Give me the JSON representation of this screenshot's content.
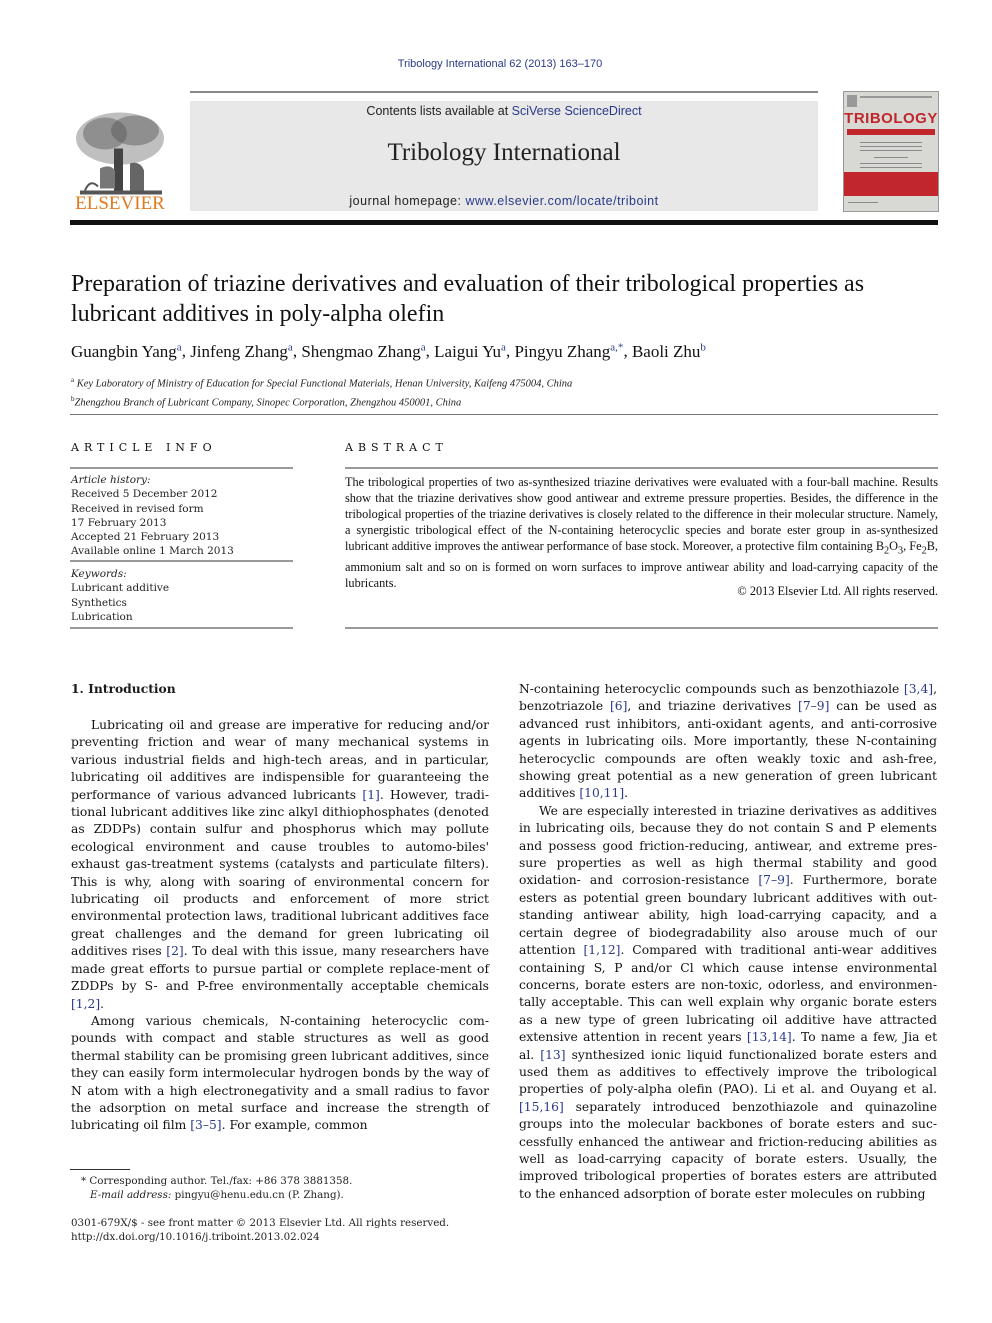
{
  "journal_ref": "Tribology International 62 (2013) 163–170",
  "banner": {
    "contents_prefix": "Contents lists available at ",
    "contents_link": "SciVerse ScienceDirect",
    "journal_name": "Tribology International",
    "homepage_prefix": "journal homepage: ",
    "homepage_link": "www.elsevier.com/locate/triboint"
  },
  "publisher_logo_text": "ELSEVIER",
  "cover": {
    "title": "TRIBOLOGY",
    "subtitle": "INTERNATIONAL"
  },
  "article": {
    "title": "Preparation of triazine derivatives and evaluation of their tribological properties as lubricant additives in poly-alpha olefin",
    "authors": [
      {
        "name": "Guangbin Yang",
        "aff": "a"
      },
      {
        "name": "Jinfeng Zhang",
        "aff": "a"
      },
      {
        "name": "Shengmao Zhang",
        "aff": "a"
      },
      {
        "name": "Laigui Yu",
        "aff": "a"
      },
      {
        "name": "Pingyu Zhang",
        "aff": "a,*"
      },
      {
        "name": "Baoli Zhu",
        "aff": "b"
      }
    ],
    "affiliations": [
      {
        "mark": "a",
        "text": "Key Laboratory of Ministry of Education for Special Functional Materials, Henan University, Kaifeng 475004, China"
      },
      {
        "mark": "b",
        "text": "Zhengzhou Branch of Lubricant Company, Sinopec Corporation, Zhengzhou 450001, China"
      }
    ]
  },
  "article_info": {
    "heading": "ARTICLE INFO",
    "history_label": "Article history:",
    "history": [
      "Received 5 December 2012",
      "Received in revised form",
      "17 February 2013",
      "Accepted 21 February 2013",
      "Available online 1 March 2013"
    ],
    "keywords_label": "Keywords:",
    "keywords": [
      "Lubricant additive",
      "Synthetics",
      "Lubrication"
    ]
  },
  "abstract": {
    "heading": "ABSTRACT",
    "text_1": "The tribological properties of two as-synthesized triazine derivatives were evaluated with a four-ball machine. Results show that the triazine derivatives show good antiwear and extreme pressure properties. Besides, the difference in the tribological properties of the triazine derivatives is closely related to the difference in their molecular structure. Namely, a synergistic tribological effect of the N-containing heterocyclic species and borate ester group in as-synthesized lubricant additive improves the antiwear performance of base stock. Moreover, a protective film containing B",
    "sub_1": "2",
    "text_2": "O",
    "sub_2": "3",
    "text_3": ", Fe",
    "sub_3": "2",
    "text_4": "B, ammonium salt and so on is formed on worn surfaces to improve antiwear ability and load-carrying capacity of the lubricants.",
    "copyright": "© 2013 Elsevier Ltd. All rights reserved."
  },
  "intro": {
    "heading": "1.   Introduction",
    "left_p1": [
      {
        "t": "Lubricating oil and grease are imperative for reducing and/or preventing friction and wear of many mechanical systems in various industrial fields and high-tech areas, and in particular, lubricating oil additives are indispensible for guaranteeing the performance of various advanced lubricants "
      },
      {
        "c": "[1]"
      },
      {
        "t": ". However, tradi-tional lubricant additives like zinc alkyl dithiophosphates (denoted as ZDDPs) contain sulfur and phosphorus which may pollute ecological environment and cause troubles to automo-biles' exhaust gas-treatment systems (catalysts and particulate filters). This is why, along with soaring of environmental concern for lubricating oil products and enforcement of more strict environmental protection laws, traditional lubricant additives face great challenges and the demand for green lubricating oil additives rises "
      },
      {
        "c": "[2]"
      },
      {
        "t": ". To deal with this issue, many researchers have made great efforts to pursue partial or complete replace-ment of ZDDPs by S- and P-free environmentally acceptable chemicals "
      },
      {
        "c": "[1,2]"
      },
      {
        "t": "."
      }
    ],
    "left_p2": [
      {
        "t": "Among various chemicals, N-containing heterocyclic com-pounds with compact and stable structures as well as good thermal stability can be promising green lubricant additives, since they can easily form intermolecular hydrogen bonds by the way of N atom with a high electronegativity and a small radius to favor the adsorption on metal surface and increase the strength of lubricating oil film "
      },
      {
        "c": "[3–5]"
      },
      {
        "t": ". For example, common"
      }
    ],
    "right_p1": [
      {
        "t": "N-containing heterocyclic compounds such as benzothiazole "
      },
      {
        "c": "[3,4]"
      },
      {
        "t": ", benzotriazole "
      },
      {
        "c": "[6]"
      },
      {
        "t": ", and triazine derivatives "
      },
      {
        "c": "[7–9]"
      },
      {
        "t": " can be used as advanced rust inhibitors, anti-oxidant agents, and anti-corrosive agents in lubricating oils. More importantly, these N-containing heterocyclic compounds are often weakly toxic and ash-free, showing great potential as a new generation of green lubricant additives "
      },
      {
        "c": "[10,11]"
      },
      {
        "t": "."
      }
    ],
    "right_p2": [
      {
        "t": "We are especially interested in triazine derivatives as additives in lubricating oils, because they do not contain S and P elements and possess good friction-reducing, antiwear, and extreme pres-sure properties as well as high thermal stability and good oxidation- and corrosion-resistance "
      },
      {
        "c": "[7–9]"
      },
      {
        "t": ". Furthermore, borate esters as potential green boundary lubricant additives with out-standing antiwear ability, high load-carrying capacity, and a certain degree of biodegradability also arouse much of our attention "
      },
      {
        "c": "[1,12]"
      },
      {
        "t": ". Compared with traditional anti-wear additives containing S, P and/or Cl which cause intense environmental concerns, borate esters are non-toxic, odorless, and environmen-tally acceptable. This can well explain why organic borate esters as a new type of green lubricating oil additive have attracted extensive attention in recent years "
      },
      {
        "c": "[13,14]"
      },
      {
        "t": ". To name a few, Jia et al. "
      },
      {
        "c": "[13]"
      },
      {
        "t": " synthesized ionic liquid functionalized borate esters and used them as additives to effectively improve the tribological properties of poly-alpha olefin (PAO). Li et al. and Ouyang et al. "
      },
      {
        "c": "[15,16]"
      },
      {
        "t": " separately introduced benzothiazole and quinazoline groups into the molecular backbones of borate esters and suc-cessfully enhanced the antiwear and friction-reducing abilities as well as load-carrying capacity of borate esters. Usually, the improved tribological properties of borates esters are attributed to the enhanced adsorption of borate ester molecules on rubbing"
      }
    ]
  },
  "footnotes": {
    "corresponding": "* Corresponding author. Tel./fax: +86 378 3881358.",
    "email_label": "E-mail address:",
    "email": " pingyu@henu.edu.cn (P. Zhang).",
    "issn": "0301-679X/$ - see front matter © 2013 Elsevier Ltd. All rights reserved.",
    "doi": "http://dx.doi.org/10.1016/j.triboint.2013.02.024"
  },
  "colors": {
    "link": "#2a3a8a",
    "elsevier_orange": "#e07a1f",
    "cover_red": "#c0262c",
    "banner_gray": "#e8e8e8"
  }
}
